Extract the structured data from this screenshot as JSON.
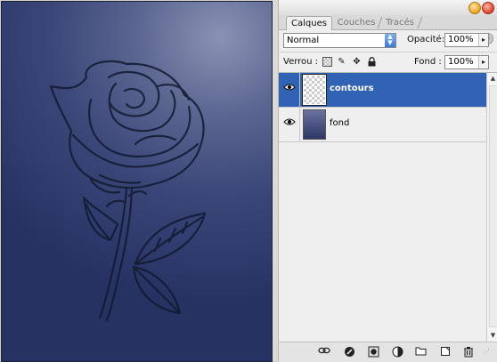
{
  "tabs": [
    {
      "label": "Calques",
      "active": true
    },
    {
      "label": "Couches",
      "active": false
    },
    {
      "label": "Tracés",
      "active": false
    }
  ],
  "blend_mode": {
    "value": "Normal"
  },
  "opacity": {
    "label": "Opacité:",
    "value": "100%"
  },
  "lock": {
    "label": "Verrou :",
    "icons": [
      "lock-transparency-icon",
      "lock-brush-icon",
      "lock-move-icon",
      "lock-all-icon"
    ]
  },
  "fill": {
    "label": "Fond :",
    "value": "100%"
  },
  "layers": [
    {
      "name": "contours",
      "selected": true,
      "visible": true,
      "thumbnail": "transparent"
    },
    {
      "name": "fond",
      "selected": false,
      "visible": true,
      "thumbnail": "blue-gradient"
    }
  ],
  "bottom_icons": [
    "link-icon",
    "styles-icon",
    "mask-icon",
    "adjustment-icon",
    "group-folder-icon",
    "new-layer-icon",
    "trash-icon"
  ],
  "colors": {
    "selection": "#3163b4",
    "canvas_dark": "#263262",
    "canvas_light": "#8a92b4"
  }
}
